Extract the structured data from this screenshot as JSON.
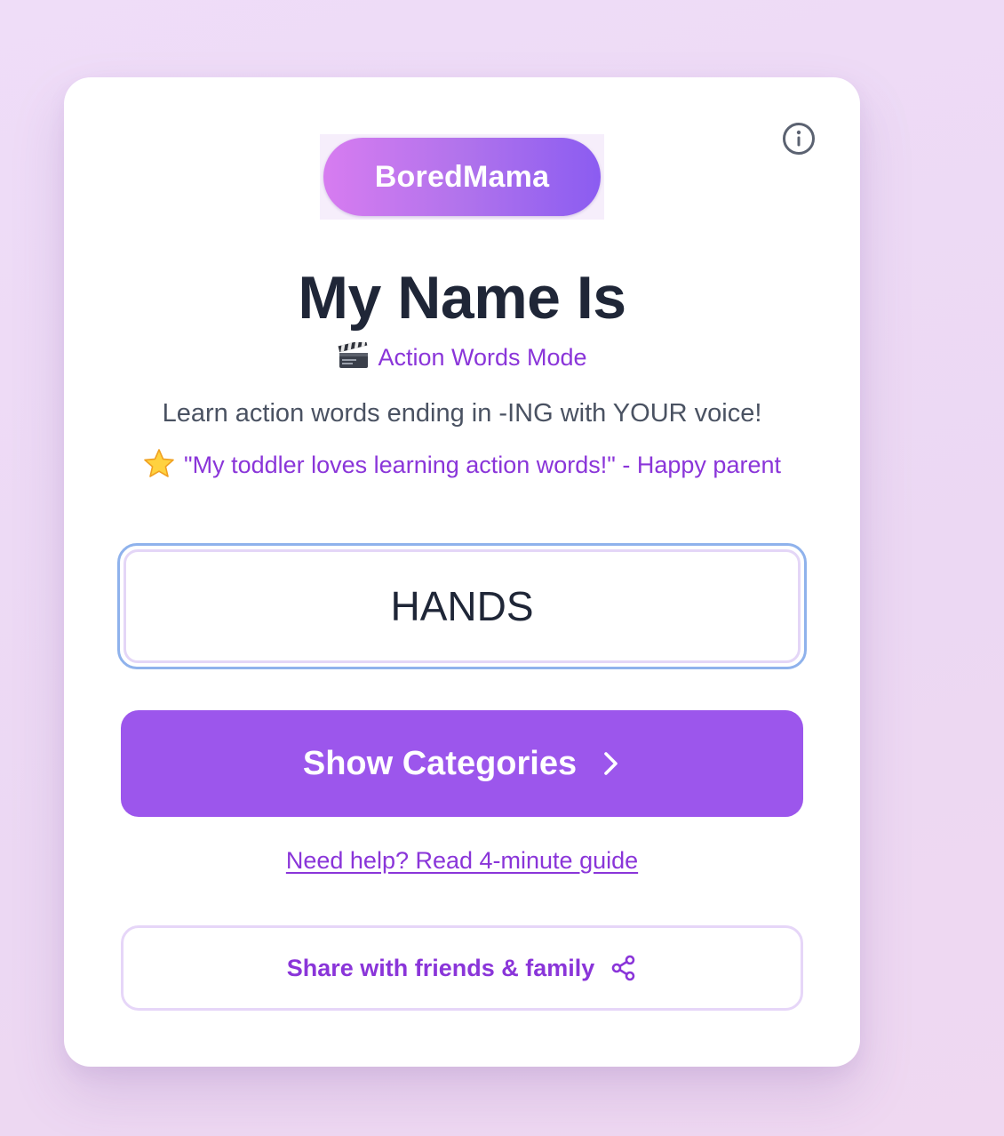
{
  "header": {
    "logo_text": "BoredMama",
    "info_icon": "info-icon"
  },
  "main": {
    "title": "My Name Is",
    "mode_icon": "clapperboard-icon",
    "mode_label": "Action Words Mode",
    "subtitle": "Learn action words ending in -ING with YOUR voice!",
    "testimonial_icon": "star-icon",
    "testimonial": "\"My toddler loves learning action words!\" - Happy parent"
  },
  "name_input": {
    "value": "HANDS",
    "placeholder": ""
  },
  "actions": {
    "show_categories_label": "Show Categories",
    "show_categories_icon": "chevron-right-icon",
    "help_link": "Need help? Read 4-minute guide",
    "share_label": "Share with friends & family",
    "share_icon": "share-icon"
  },
  "colors": {
    "accent": "#9c56ec",
    "accent_text": "#8a35d9",
    "title_text": "#1f2637",
    "focus_ring": "#8fb2ec"
  }
}
